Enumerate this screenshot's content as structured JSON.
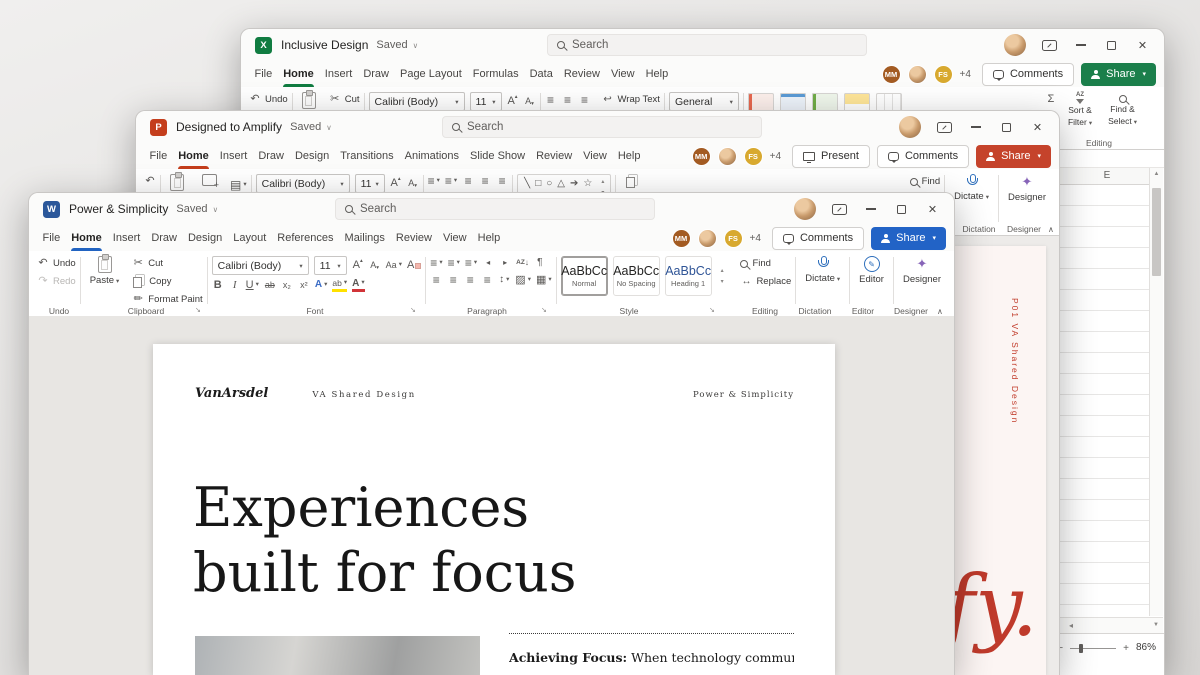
{
  "excel": {
    "title": "Inclusive Design",
    "saved": "Saved",
    "search_placeholder": "Search",
    "tabs": [
      "File",
      "Home",
      "Insert",
      "Draw",
      "Page Layout",
      "Formulas",
      "Data",
      "Review",
      "View",
      "Help"
    ],
    "presence": {
      "p1": "MM",
      "p2": "FS",
      "more": "+4"
    },
    "comments_label": "Comments",
    "share_label": "Share",
    "ribbon": {
      "undo": "Undo",
      "cut": "Cut",
      "font_name": "Calibri (Body)",
      "font_size": "11",
      "wrap_text": "Wrap Text",
      "number_format": "General",
      "sort_filter_1": "Sort &",
      "sort_filter_2": "Filter",
      "find_select_1": "Find &",
      "find_select_2": "Select",
      "editing_group": "Editing"
    },
    "sheet": {
      "visible_column": "E"
    },
    "status": {
      "zoom_out": "−",
      "zoom_in": "+",
      "zoom_value": "86%"
    }
  },
  "powerpoint": {
    "title": "Designed to Amplify",
    "saved": "Saved",
    "search_placeholder": "Search",
    "tabs": [
      "File",
      "Home",
      "Insert",
      "Draw",
      "Design",
      "Transitions",
      "Animations",
      "Slide Show",
      "Review",
      "View",
      "Help"
    ],
    "presence": {
      "p1": "MM",
      "p2": "FS",
      "more": "+4"
    },
    "present_label": "Present",
    "comments_label": "Comments",
    "share_label": "Share",
    "ribbon": {
      "font_name": "Calibri (Body)",
      "font_size": "11",
      "find": "Find",
      "dictate": "Dictate",
      "designer": "Designer",
      "dictation_group": "Dictation",
      "designer_group": "Designer"
    },
    "slide": {
      "side_label": "P01   VA Shared Design",
      "big_text": "fy."
    }
  },
  "word": {
    "title": "Power & Simplicity",
    "saved": "Saved",
    "search_placeholder": "Search",
    "tabs": [
      "File",
      "Home",
      "Insert",
      "Draw",
      "Design",
      "Layout",
      "References",
      "Mailings",
      "Review",
      "View",
      "Help"
    ],
    "presence": {
      "p1": "MM",
      "p2": "FS",
      "more": "+4"
    },
    "comments_label": "Comments",
    "share_label": "Share",
    "ribbon": {
      "undo": "Undo",
      "redo": "Redo",
      "paste": "Paste",
      "cut": "Cut",
      "copy": "Copy",
      "format_painter": "Format Paint",
      "font_name": "Calibri (Body)",
      "font_size": "11",
      "styles": [
        {
          "sample": "AaBbCc",
          "name": "Normal"
        },
        {
          "sample": "AaBbCc",
          "name": "No Spacing"
        },
        {
          "sample": "AaBbCc",
          "name": "Heading 1"
        }
      ],
      "find": "Find",
      "replace": "Replace",
      "dictate": "Dictate",
      "editor": "Editor",
      "designer": "Designer",
      "groups": {
        "undo": "Undo",
        "clipboard": "Clipboard",
        "font": "Font",
        "paragraph": "Paragraph",
        "style": "Style",
        "editing": "Editing",
        "dictation": "Dictation",
        "editor": "Editor",
        "designer": "Designer"
      }
    },
    "document": {
      "logo": "VanArsdel",
      "header_center": "VA Shared Design",
      "header_right": "Power & Simplicity",
      "heading_line1": "Experiences",
      "heading_line2": "built for focus",
      "para_lead": "Achieving Focus:",
      "para_rest": " When technology communicates and"
    }
  }
}
